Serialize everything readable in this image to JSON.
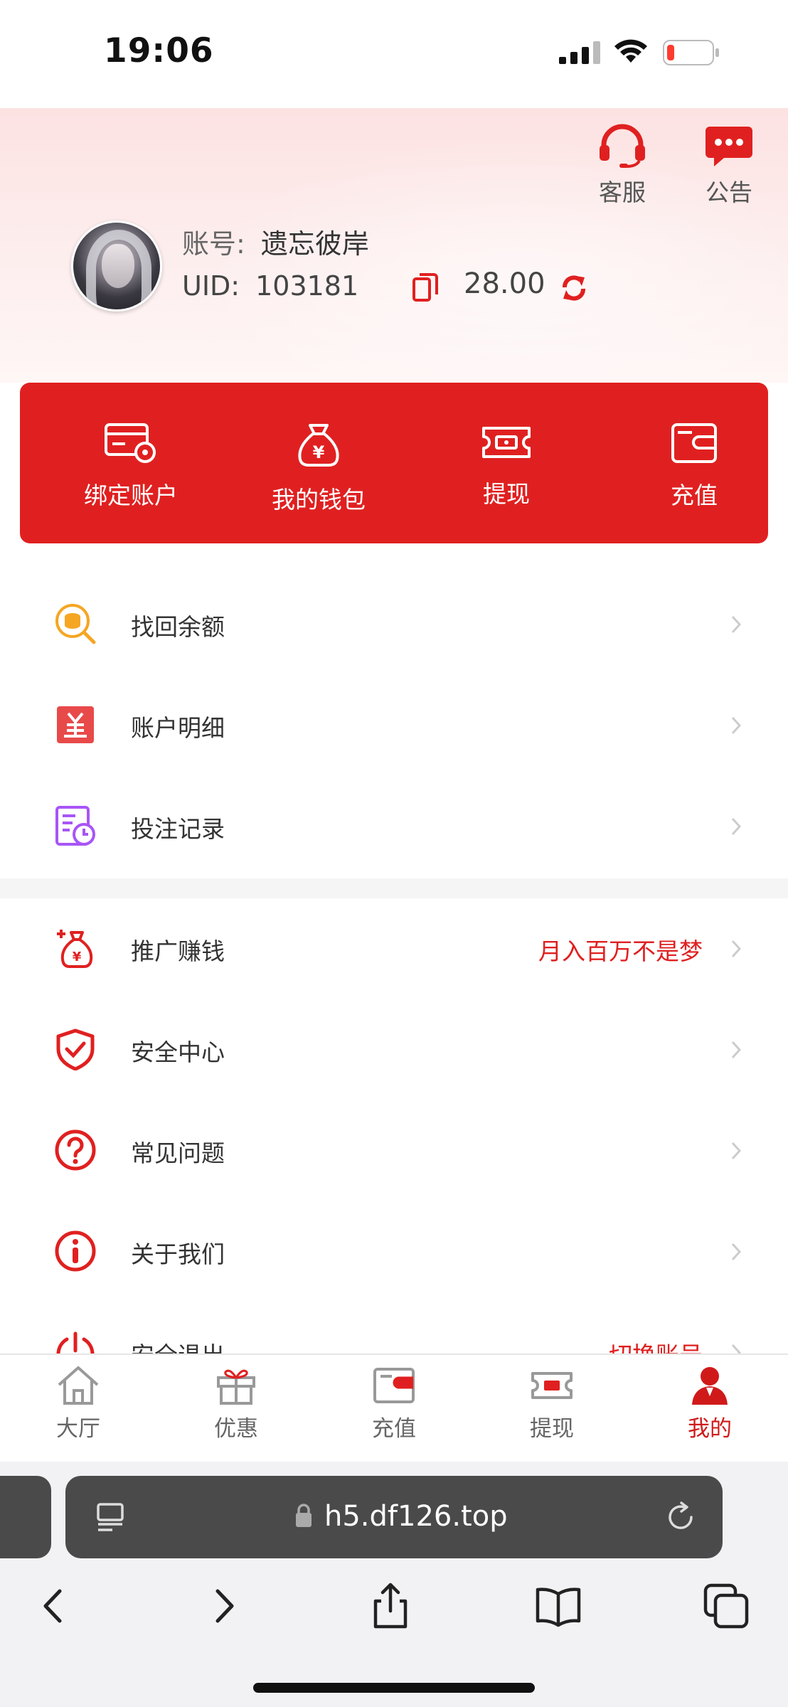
{
  "status_bar": {
    "time": "19:06"
  },
  "header": {
    "service_label": "客服",
    "notice_label": "公告",
    "account_key": "账号:",
    "account_value": "遗忘彼岸",
    "uid_key": "UID:",
    "uid_value": "103181",
    "balance": "28.00"
  },
  "actions": [
    {
      "label": "绑定账户",
      "icon": "card-settings-icon"
    },
    {
      "label": "我的钱包",
      "icon": "money-bag-icon"
    },
    {
      "label": "提现",
      "icon": "ticket-icon"
    },
    {
      "label": "充值",
      "icon": "wallet-icon"
    }
  ],
  "menu_group_1": [
    {
      "label": "找回余额",
      "icon": "coin-search-icon"
    },
    {
      "label": "账户明细",
      "icon": "yen-document-icon"
    },
    {
      "label": "投注记录",
      "icon": "record-clock-icon"
    }
  ],
  "menu_group_2": [
    {
      "label": "推广赚钱",
      "extra": "月入百万不是梦",
      "icon": "money-bag-plus-icon"
    },
    {
      "label": "安全中心",
      "icon": "shield-check-icon"
    },
    {
      "label": "常见问题",
      "icon": "question-circle-icon"
    },
    {
      "label": "关于我们",
      "icon": "info-circle-icon"
    },
    {
      "label": "安全退出",
      "extra": "切换账号",
      "icon": "power-icon"
    }
  ],
  "tabbar": [
    {
      "label": "大厅",
      "icon": "home-icon"
    },
    {
      "label": "优惠",
      "icon": "gift-icon"
    },
    {
      "label": "充值",
      "icon": "wallet-icon"
    },
    {
      "label": "提现",
      "icon": "ticket-icon"
    },
    {
      "label": "我的",
      "icon": "person-icon",
      "active": true
    }
  ],
  "browser": {
    "url": "h5.df126.top"
  },
  "colors": {
    "accent": "#e02020",
    "header_bg": "#fde2e2",
    "active_tab": "#d01a1a"
  }
}
